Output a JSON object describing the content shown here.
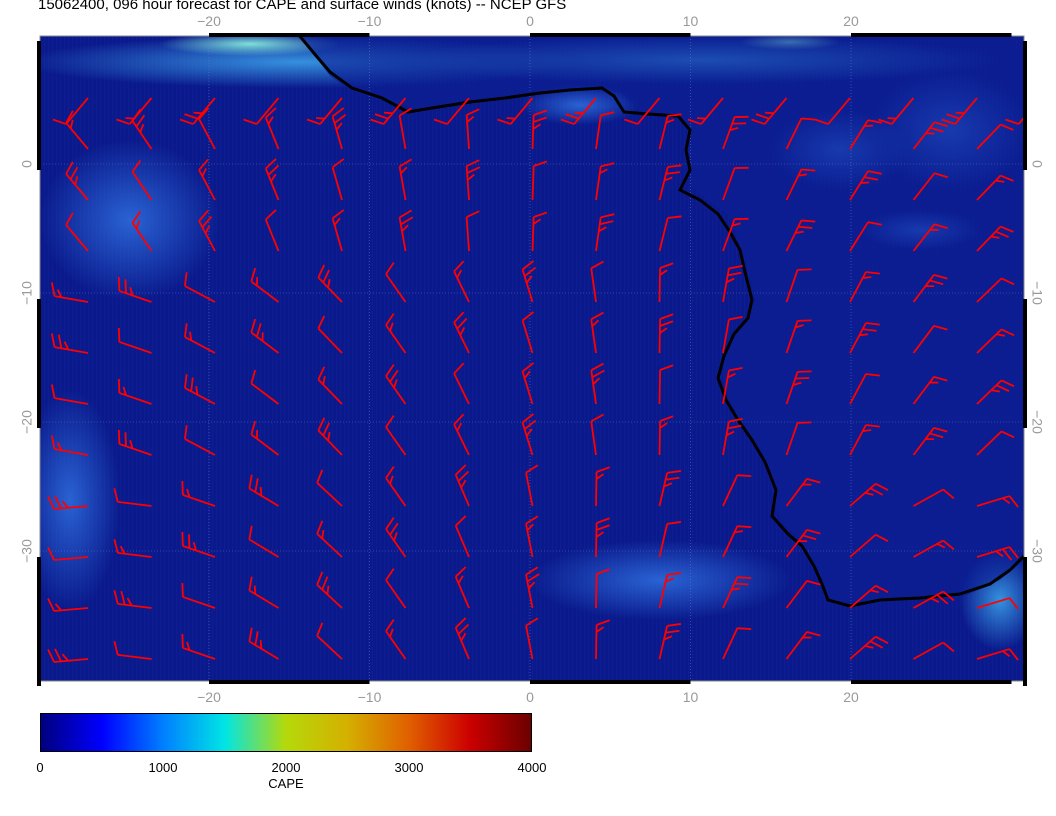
{
  "title": "15062400, 096 hour forecast for CAPE and surface winds (knots) -- NCEP GFS",
  "map": {
    "lon_range": [
      -31,
      31
    ],
    "lat_range": [
      -39,
      11
    ],
    "lon_ticks": [
      -20,
      -10,
      0,
      10,
      20
    ],
    "lat_ticks": [
      0,
      -10,
      -20,
      -30
    ],
    "lon_tick_labels": [
      "−20",
      "−10",
      "0",
      "10",
      "20"
    ],
    "lat_tick_labels": [
      "0",
      "−10",
      "−20",
      "−30"
    ],
    "ocean_color": "#0a1a8c",
    "coast_color": "#000000",
    "wind_barb_color": "#ff0000"
  },
  "colorbar": {
    "title": "CAPE",
    "min": 0,
    "max": 4000,
    "tick_labels": [
      "0",
      "1000",
      "2000",
      "3000",
      "4000"
    ],
    "colors": [
      "#00007f",
      "#0000ff",
      "#0080ff",
      "#00e5e5",
      "#b5d90a",
      "#d4b000",
      "#e06000",
      "#cc0000",
      "#6b0000"
    ]
  }
}
